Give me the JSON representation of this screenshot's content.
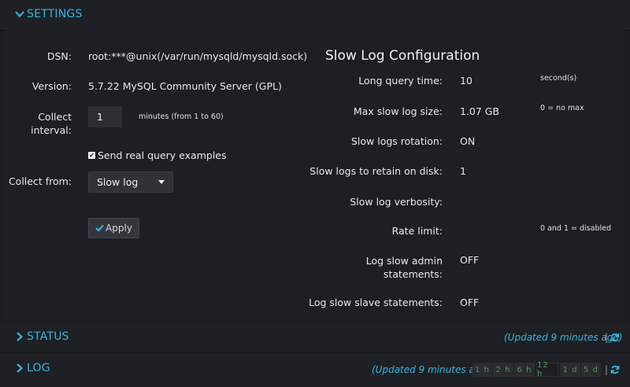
{
  "settings": {
    "title": "SETTINGS",
    "dsn_label": "DSN:",
    "dsn_value": "root:***@unix(/var/run/mysqld/mysqld.sock)",
    "version_label": "Version:",
    "version_value": "5.7.22 MySQL Community Server (GPL)",
    "collect_interval_label_1": "Collect",
    "collect_interval_label_2": "interval:",
    "collect_interval_value": "1",
    "collect_interval_hint": "minutes (from 1 to 60)",
    "send_examples_label": "Send real query examples",
    "send_examples_checked": true,
    "collect_from_label": "Collect from:",
    "collect_from_value": "Slow log",
    "apply_label": "Apply"
  },
  "slow_log": {
    "heading": "Slow Log Configuration",
    "rows": [
      {
        "label": "Long query time:",
        "value": "10",
        "hint": "second(s)"
      },
      {
        "label": "Max slow log size:",
        "value": "1.07 GB",
        "hint": "0 = no max"
      },
      {
        "label": "Slow logs rotation:",
        "value": "ON",
        "hint": ""
      },
      {
        "label": "Slow logs to retain on disk:",
        "value": "1",
        "hint": ""
      },
      {
        "label": "Slow log verbosity:",
        "value": "",
        "hint": ""
      },
      {
        "label": "Rate limit:",
        "value": "",
        "hint": "0 and 1 = disabled"
      },
      {
        "label_1": "Log slow admin",
        "label_2": "statements:",
        "value": "OFF",
        "hint": ""
      },
      {
        "label": "Log slow slave statements:",
        "value": "OFF",
        "hint": ""
      }
    ]
  },
  "status": {
    "title": "STATUS",
    "updated": "(Updated 9 minutes ago)",
    "separator": "|"
  },
  "log": {
    "title": "LOG",
    "updated": "(Updated 9 minutes ago)",
    "separator": "|",
    "ranges": [
      "1 h",
      "2 h",
      "6 h",
      "12 h",
      "1 d",
      "5 d"
    ],
    "active_range": "12 h"
  },
  "colors": {
    "accent": "#35b4e0",
    "range_text": "#4d9a52"
  },
  "icons": {
    "section_expanded": "chevron-down-icon",
    "section_collapsed": "chevron-right-icon",
    "apply": "check-icon",
    "refresh": "refresh-icon",
    "select": "caret-down-icon"
  }
}
